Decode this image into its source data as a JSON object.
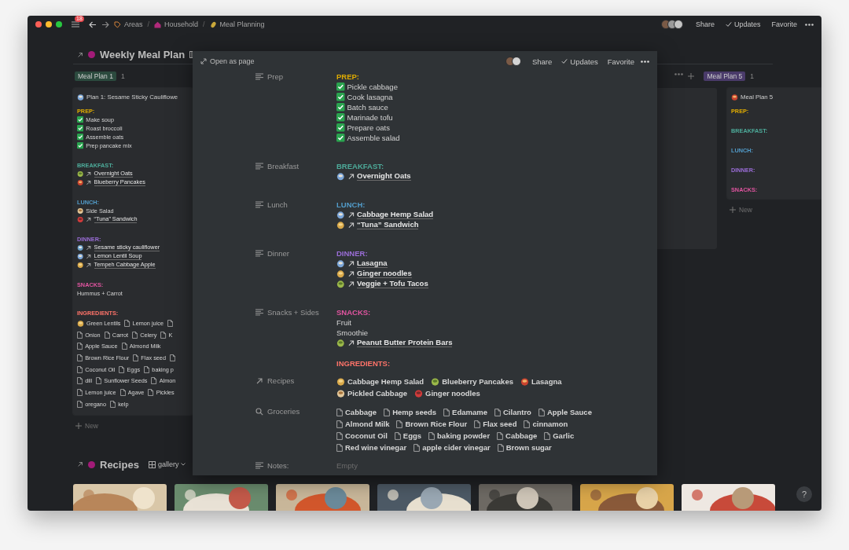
{
  "topbar": {
    "notifications": "18",
    "breadcrumb": [
      {
        "kind": "crumb",
        "label": "Areas"
      },
      {
        "kind": "separator",
        "label": "/"
      },
      {
        "kind": "crumb",
        "label": "Household"
      },
      {
        "kind": "separator",
        "label": "/"
      },
      {
        "kind": "crumb",
        "label": "Meal Planning"
      }
    ],
    "actions": [
      {
        "kind": "plain",
        "label": "Share"
      },
      {
        "kind": "check",
        "label": "Updates"
      },
      {
        "kind": "plain",
        "label": "Favorite"
      }
    ]
  },
  "board": {
    "title": "Weekly Meal Plan",
    "columns": [
      {
        "group": {
          "label": "Meal Plan 1",
          "count": "1",
          "color": "#2b4a3e"
        },
        "new_label": "New",
        "cards": [
          {
            "title": "Plan 1: Sesame Sticky Cauliflowe",
            "blocks": [
              {
                "heading": "PREP:",
                "color": "#dfab01",
                "items": [
                  {
                    "kind": "todo",
                    "text": "Make soup",
                    "checked": true
                  },
                  {
                    "kind": "todo",
                    "text": "Roast broccoli",
                    "checked": true
                  },
                  {
                    "kind": "todo",
                    "text": "Assemble oats",
                    "checked": true
                  },
                  {
                    "kind": "todo",
                    "text": "Prep pancake mix",
                    "checked": true
                  }
                ]
              },
              {
                "heading": "BREAKFAST:",
                "color": "#4dab9a",
                "items": [
                  {
                    "kind": "link",
                    "text": "Overnight Oats"
                  },
                  {
                    "kind": "link",
                    "text": "Blueberry Pancakes"
                  }
                ]
              },
              {
                "heading": "LUNCH:",
                "color": "#529cca",
                "items": [
                  {
                    "kind": "emoji",
                    "text": "Side Salad"
                  },
                  {
                    "kind": "link",
                    "text": "“Tuna” Sandwich"
                  }
                ]
              },
              {
                "heading": "DINNER:",
                "color": "#9a6dd7",
                "items": [
                  {
                    "kind": "link",
                    "text": "Sesame sticky cauliflower"
                  },
                  {
                    "kind": "link",
                    "text": "Lemon Lentil Soup"
                  },
                  {
                    "kind": "link",
                    "text": "Tempeh Cabbage Apple"
                  }
                ]
              },
              {
                "heading": "SNACKS:",
                "color": "#e255a1",
                "items": [
                  {
                    "kind": "text",
                    "text": "Hummus + Carrot"
                  }
                ]
              },
              {
                "heading": "INGREDIENTS:",
                "color": "#ff7369",
                "lines": [
                  [
                    {
                      "kind": "recipe",
                      "text": "Green Lentils"
                    },
                    {
                      "kind": "page",
                      "text": "Lemon juice"
                    },
                    {
                      "kind": "page"
                    }
                  ],
                  [
                    {
                      "kind": "page",
                      "text": "Onion"
                    },
                    {
                      "kind": "page",
                      "text": "Carrot"
                    },
                    {
                      "kind": "page",
                      "text": "Celery"
                    },
                    {
                      "kind": "page",
                      "text": "K"
                    }
                  ],
                  [
                    {
                      "kind": "page",
                      "text": "Apple Sauce"
                    },
                    {
                      "kind": "page",
                      "text": "Almond Milk"
                    }
                  ],
                  [
                    {
                      "kind": "page",
                      "text": "Brown Rice Flour"
                    },
                    {
                      "kind": "page",
                      "text": "Flax seed"
                    },
                    {
                      "kind": "page"
                    }
                  ],
                  [
                    {
                      "kind": "page",
                      "text": "Coconut Oil"
                    },
                    {
                      "kind": "page",
                      "text": "Eggs"
                    },
                    {
                      "kind": "page",
                      "text": "baking p"
                    }
                  ],
                  [
                    {
                      "kind": "page",
                      "text": "dill"
                    },
                    {
                      "kind": "page",
                      "text": "Sunflower Seeds"
                    },
                    {
                      "kind": "page",
                      "text": "Almon"
                    }
                  ],
                  [
                    {
                      "kind": "page",
                      "text": "Lemon juice"
                    },
                    {
                      "kind": "page",
                      "text": "Agave"
                    },
                    {
                      "kind": "page",
                      "text": "Pickles"
                    }
                  ],
                  [
                    {
                      "kind": "page",
                      "text": "oregano"
                    },
                    {
                      "kind": "page",
                      "text": "kelp"
                    }
                  ]
                ]
              }
            ]
          }
        ]
      },
      {
        "group": {
          "label": "Meal Plan 5",
          "count": "1",
          "color": "#4a3b6a"
        },
        "new_label": "New",
        "cards": [
          {
            "title": "Meal Plan 5",
            "blocks": [
              {
                "heading": "PREP:",
                "color": "#dfab01"
              },
              {
                "heading": "BREAKFAST:",
                "color": "#4dab9a"
              },
              {
                "heading": "LUNCH:",
                "color": "#529cca"
              },
              {
                "heading": "DINNER:",
                "color": "#9a6dd7"
              },
              {
                "heading": "SNACKS:",
                "color": "#e255a1"
              }
            ]
          }
        ]
      }
    ]
  },
  "recipes": {
    "title": "Recipes",
    "view": "gallery"
  },
  "help": "?",
  "modal": {
    "open_label": "Open as page",
    "actions": [
      {
        "kind": "plain",
        "label": "Share"
      },
      {
        "kind": "check",
        "label": "Updates"
      },
      {
        "kind": "plain",
        "label": "Favorite"
      }
    ],
    "properties": [
      {
        "label": "Prep",
        "kind": "text",
        "blocks": [
          {
            "heading": "PREP:",
            "color": "#dfab01",
            "items": [
              {
                "kind": "todo",
                "text": "Pickle cabbage",
                "checked": true
              },
              {
                "kind": "todo",
                "text": "Cook lasagna",
                "checked": true
              },
              {
                "kind": "todo",
                "text": "Batch sauce",
                "checked": true
              },
              {
                "kind": "todo",
                "text": "Marinade tofu",
                "checked": true
              },
              {
                "kind": "todo",
                "text": "Prepare oats",
                "checked": true
              },
              {
                "kind": "todo",
                "text": "Assemble salad",
                "checked": true
              }
            ]
          }
        ]
      },
      {
        "label": "Breakfast",
        "kind": "text",
        "blocks": [
          {
            "heading": "BREAKFAST:",
            "color": "#4dab9a",
            "items": [
              {
                "kind": "link",
                "text": "Overnight Oats"
              }
            ]
          }
        ]
      },
      {
        "label": "Lunch",
        "kind": "text",
        "blocks": [
          {
            "heading": "LUNCH:",
            "color": "#529cca",
            "items": [
              {
                "kind": "link",
                "text": "Cabbage Hemp Salad"
              },
              {
                "kind": "link",
                "text": "“Tuna” Sandwich"
              }
            ]
          }
        ]
      },
      {
        "label": "Dinner",
        "kind": "text",
        "blocks": [
          {
            "heading": "DINNER:",
            "color": "#9a6dd7",
            "items": [
              {
                "kind": "link",
                "text": "Lasagna"
              },
              {
                "kind": "link",
                "text": "Ginger noodles"
              },
              {
                "kind": "link",
                "text": "Veggie + Tofu Tacos"
              }
            ]
          }
        ]
      },
      {
        "label": "Snacks + Sides",
        "kind": "text",
        "blocks": [
          {
            "heading": "SNACKS:",
            "color": "#e255a1",
            "items": [
              {
                "kind": "text",
                "text": "Fruit"
              },
              {
                "kind": "text",
                "text": "Smoothie"
              },
              {
                "kind": "link",
                "text": "Peanut Butter Protein Bars"
              }
            ]
          },
          {
            "heading": "INGREDIENTS:",
            "color": "#ff7369"
          }
        ]
      },
      {
        "label": "Recipes",
        "kind": "relation",
        "lines": [
          [
            {
              "kind": "recipe",
              "text": "Cabbage Hemp Salad"
            },
            {
              "kind": "recipe",
              "text": "Blueberry Pancakes"
            },
            {
              "kind": "recipe",
              "text": "Lasagna"
            }
          ],
          [
            {
              "kind": "recipe",
              "text": "Pickled Cabbage"
            },
            {
              "kind": "recipe",
              "text": "Ginger noodles"
            }
          ]
        ]
      },
      {
        "label": "Groceries",
        "kind": "rollup",
        "lines": [
          [
            {
              "kind": "page",
              "text": "Cabbage"
            },
            {
              "kind": "page",
              "text": "Hemp seeds"
            },
            {
              "kind": "page",
              "text": "Edamame"
            },
            {
              "kind": "page",
              "text": "Cilantro"
            },
            {
              "kind": "page",
              "text": "Apple Sauce"
            }
          ],
          [
            {
              "kind": "page",
              "text": "Almond Milk"
            },
            {
              "kind": "page",
              "text": "Brown Rice Flour"
            },
            {
              "kind": "page",
              "text": "Flax seed"
            },
            {
              "kind": "page",
              "text": "cinnamon"
            }
          ],
          [
            {
              "kind": "page",
              "text": "Coconut Oil"
            },
            {
              "kind": "page",
              "text": "Eggs"
            },
            {
              "kind": "page",
              "text": "baking powder"
            },
            {
              "kind": "page",
              "text": "Cabbage"
            },
            {
              "kind": "page",
              "text": "Garlic"
            }
          ],
          [
            {
              "kind": "page",
              "text": "Red wine vinegar"
            },
            {
              "kind": "page",
              "text": "apple cider vinegar"
            },
            {
              "kind": "page",
              "text": "Brown sugar"
            }
          ]
        ]
      },
      {
        "label": "Notes:",
        "kind": "text",
        "placeholder": "Empty"
      }
    ]
  }
}
